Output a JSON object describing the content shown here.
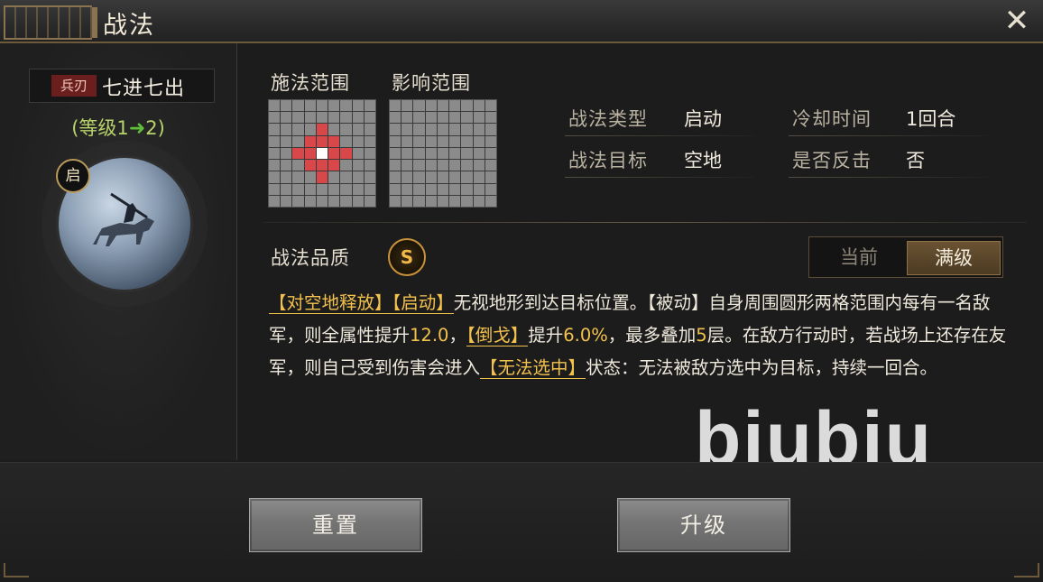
{
  "window": {
    "title": "战法",
    "close_icon": "close-icon"
  },
  "skill": {
    "weapon_tag": "兵刃",
    "name": "七进七出",
    "level_prefix": "(等级1",
    "level_arrow": "➜",
    "level_suffix": "2)",
    "badge": "启"
  },
  "ranges": {
    "cast_label": "施法范围",
    "effect_label": "影响范围"
  },
  "info": {
    "type_label": "战法类型",
    "type_value": "启动",
    "cooldown_label": "冷却时间",
    "cooldown_value": "1回合",
    "target_label": "战法目标",
    "target_value": "空地",
    "counter_label": "是否反击",
    "counter_value": "否"
  },
  "quality": {
    "label": "战法品质",
    "grade": "S"
  },
  "toggle": {
    "current": "当前",
    "max": "满级",
    "selected": "满级"
  },
  "description": {
    "p1": "【对空地释放】",
    "p2": "【启动】",
    "p3": "无视地形到达目标位置。【被动】自身周围圆形两格范围内每有一名敌军，则全属性提升",
    "n1": "12.0",
    "p4": "，",
    "p5": "【倒戈】",
    "p6": "提升",
    "n2": "6.0%",
    "p7": "，最多叠加",
    "n3": "5",
    "p8": "层。在敌方行动时，若战场上还存在友军，则自己受到伤害会进入",
    "p9": "【无法选中】",
    "p10": "状态：无法被敌方选中为目标，持续一回合。"
  },
  "watermark": "biubiu",
  "buttons": {
    "reset": "重置",
    "upgrade": "升级"
  },
  "colors": {
    "accent_gold": "#f3c24d",
    "cell_red": "#d8484a",
    "cell_gray": "#8b8b8b",
    "level_green": "#b8d36a"
  }
}
